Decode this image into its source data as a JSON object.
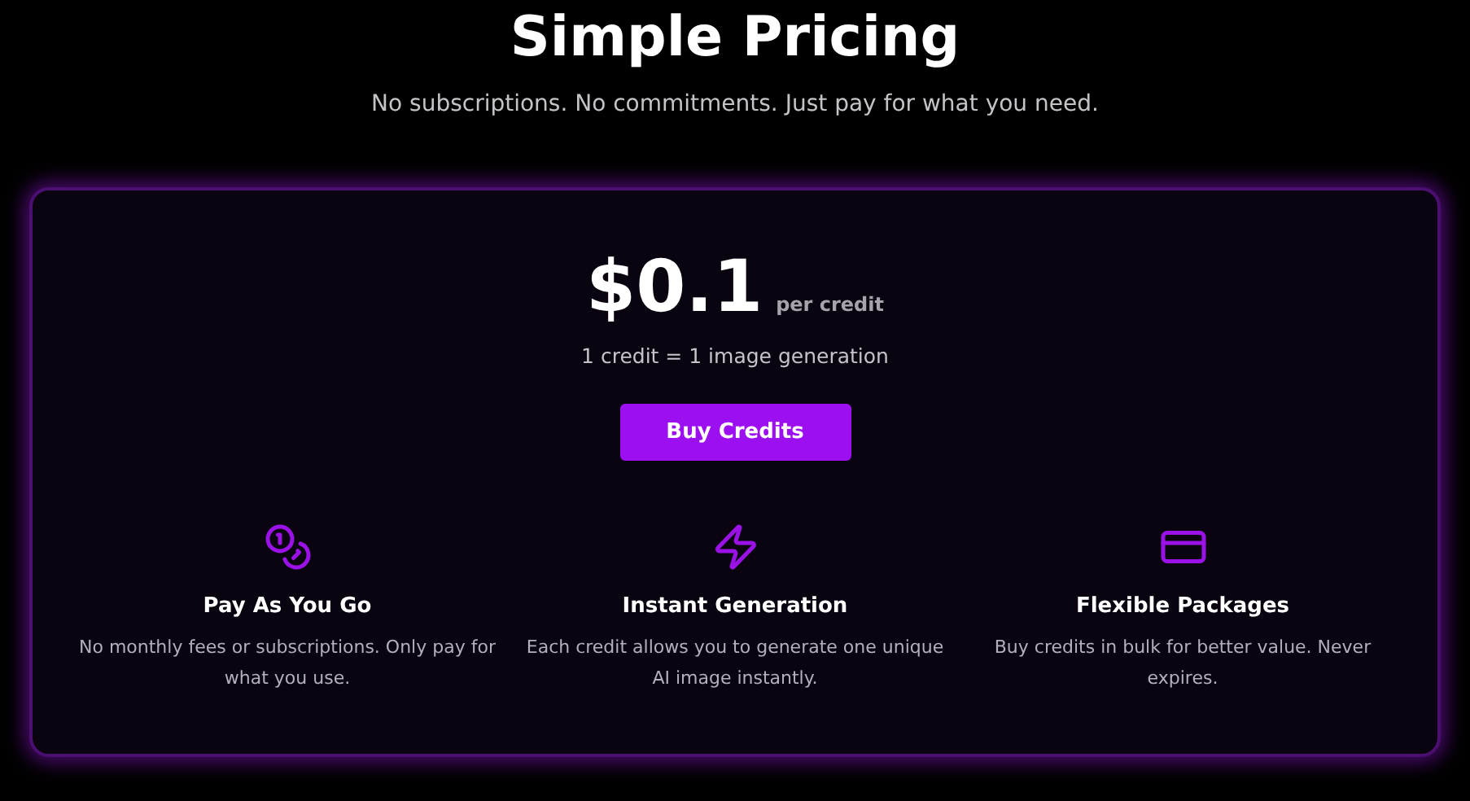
{
  "header": {
    "title": "Simple Pricing",
    "subtitle": "No subscriptions. No commitments. Just pay for what you need."
  },
  "pricing_card": {
    "price": "$0.1",
    "unit": "per credit",
    "note": "1 credit = 1 image generation",
    "button": "Buy Credits",
    "features": [
      {
        "kind": "coins",
        "title": "Pay As You Go",
        "description": "No monthly fees or subscriptions. Only pay for what you use."
      },
      {
        "kind": "bolt",
        "title": "Instant Generation",
        "description": "Each credit allows you to generate one unique AI image instantly."
      },
      {
        "kind": "card",
        "title": "Flexible Packages",
        "description": "Buy credits in bulk for better value. Never expires."
      }
    ]
  }
}
